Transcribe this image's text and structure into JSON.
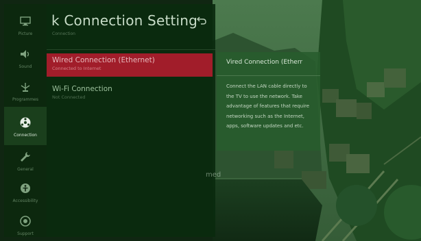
{
  "rail": {
    "items": [
      {
        "label": "Picture",
        "icon": "picture-icon",
        "active": false
      },
      {
        "label": "Sound",
        "icon": "speaker-icon",
        "active": false
      },
      {
        "label": "Programmes",
        "icon": "antenna-icon",
        "active": false
      },
      {
        "label": "Connection",
        "icon": "connection-icon",
        "active": true
      },
      {
        "label": "General",
        "icon": "wrench-icon",
        "active": false
      },
      {
        "label": "Accessibility",
        "icon": "accessibility-icon",
        "active": false
      },
      {
        "label": "Support",
        "icon": "support-icon",
        "active": false
      }
    ]
  },
  "panel": {
    "title": "k Connection Setting",
    "subtitle": "Connection"
  },
  "menu": {
    "items": [
      {
        "title": "Wired Connection (Ethernet)",
        "status": "Connected to Internet",
        "selected": true
      },
      {
        "title": "Wi-Fi Connection",
        "status": "Not Connected",
        "selected": false
      }
    ]
  },
  "tooltip": {
    "title": "Vired Connection (Etherr",
    "body": "Connect the LAN cable directly to the TV to use the network. Take advantage of features that require networking such as the Internet, apps, software updates and etc."
  },
  "background_fragment": "med",
  "colors": {
    "accent": "#a11d2a",
    "overlay_tint": "#0a2a0e"
  }
}
